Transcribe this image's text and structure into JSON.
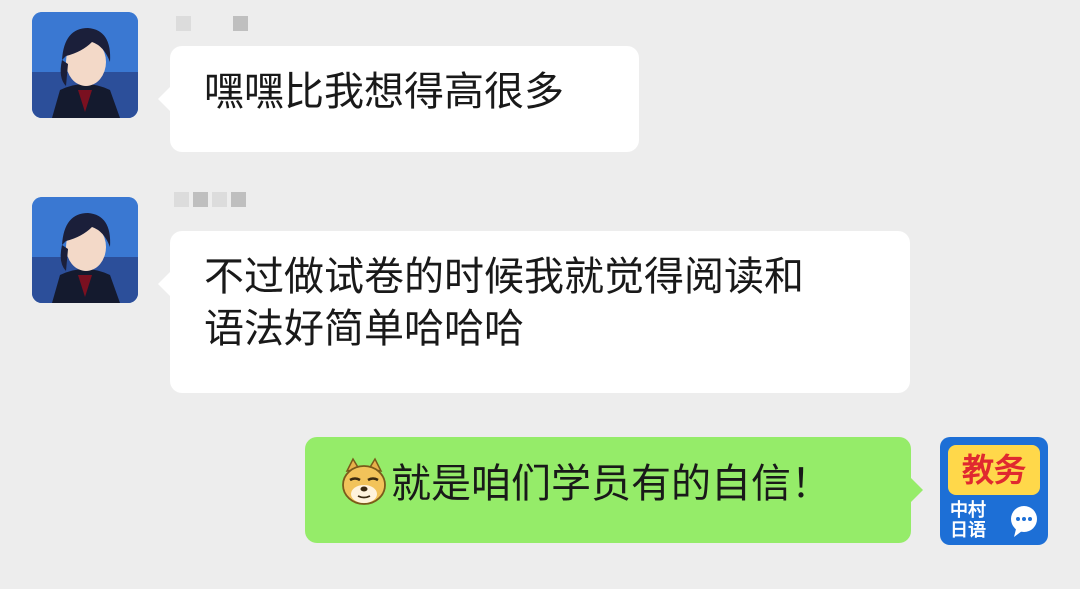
{
  "messages": [
    {
      "sender": "contact",
      "lines": [
        "嘿嘿比我想得高很多"
      ]
    },
    {
      "sender": "contact",
      "lines": [
        "不过做试卷的时候我就觉得阅读和",
        "语法好简单哈哈哈"
      ]
    },
    {
      "sender": "self",
      "emoji": "doge-icon",
      "lines": [
        "就是咱们学员有的自信！"
      ]
    }
  ],
  "self_avatar": {
    "title": "教务",
    "sub_line1": "中村",
    "sub_line2": "日语"
  },
  "colors": {
    "background": "#ededed",
    "incoming_bubble": "#ffffff",
    "outgoing_bubble": "#95ec69"
  }
}
